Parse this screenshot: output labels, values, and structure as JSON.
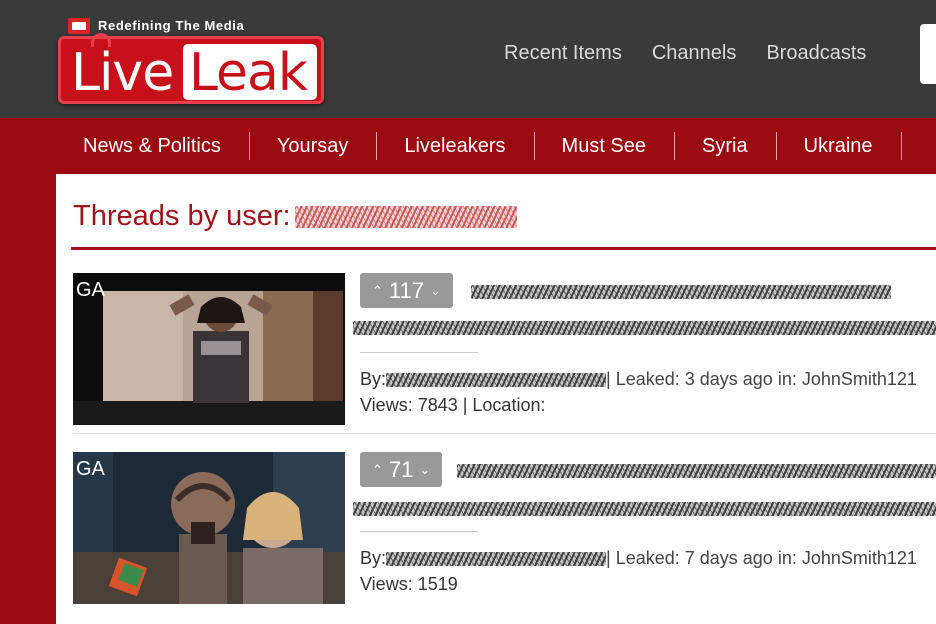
{
  "header": {
    "tagline": "Redefining The Media",
    "logo_live": "Live",
    "logo_leak": "Leak",
    "nav": [
      "Recent Items",
      "Channels",
      "Broadcasts"
    ]
  },
  "categories": [
    "News & Politics",
    "Yoursay",
    "Liveleakers",
    "Must See",
    "Syria",
    "Ukraine"
  ],
  "page": {
    "title": "Threads by user:"
  },
  "items": [
    {
      "thumb_label": "GA",
      "votes": "117",
      "by_label": "By:",
      "leaked": "| Leaked: 3 days ago in: JohnSmith121",
      "views": "Views: 7843 | Location:"
    },
    {
      "thumb_label": "GA",
      "votes": "71",
      "by_label": "By:",
      "leaked": "| Leaked: 7 days ago in: JohnSmith121",
      "views": "Views: 1519"
    }
  ],
  "colors": {
    "brand_red": "#9b0a10",
    "header_dark": "#3a3a3a",
    "vote_gray": "#999999"
  }
}
